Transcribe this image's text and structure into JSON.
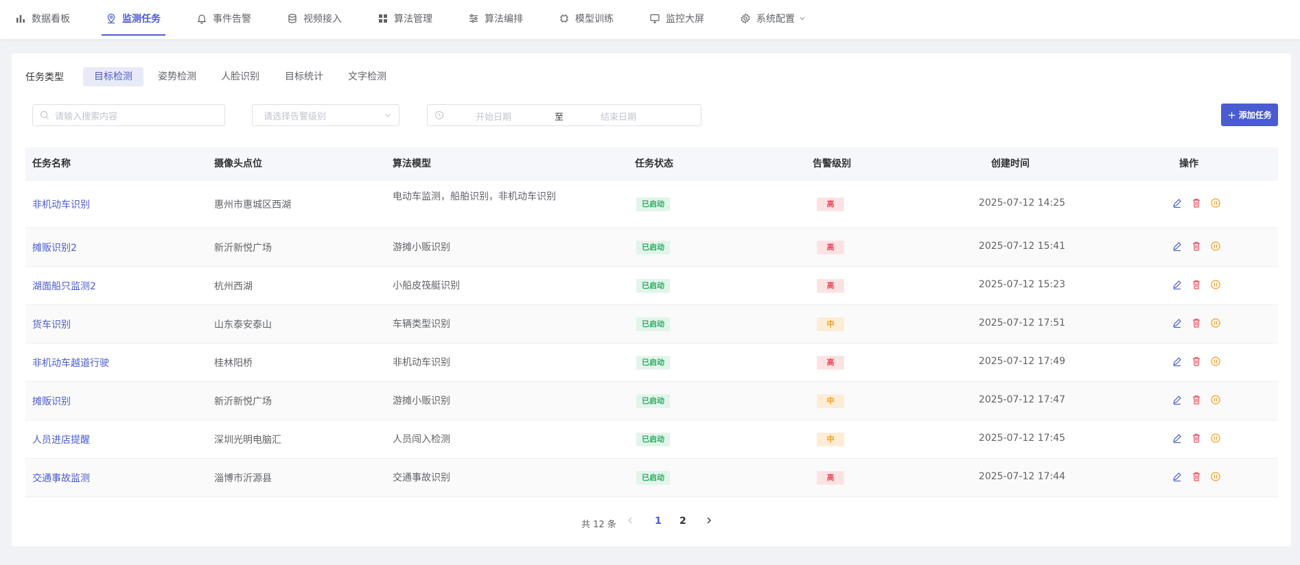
{
  "nav": {
    "items": [
      {
        "label": "数据看板",
        "icon": "bar-chart-icon"
      },
      {
        "label": "监测任务",
        "icon": "location-pin-icon"
      },
      {
        "label": "事件告警",
        "icon": "bell-icon"
      },
      {
        "label": "视频接入",
        "icon": "database-icon"
      },
      {
        "label": "算法管理",
        "icon": "grid-icon"
      },
      {
        "label": "算法编排",
        "icon": "sliders-icon"
      },
      {
        "label": "模型训练",
        "icon": "chip-icon"
      },
      {
        "label": "监控大屏",
        "icon": "monitor-icon"
      },
      {
        "label": "系统配置",
        "icon": "gear-icon"
      }
    ],
    "active_index": 1
  },
  "filters": {
    "task_type_label": "任务类型",
    "tabs": [
      "目标检测",
      "姿势检测",
      "人脸识别",
      "目标统计",
      "文字检测"
    ],
    "active_tab": 0,
    "search_placeholder": "请输入搜索内容",
    "alert_level_placeholder": "请选择告警级别",
    "date_start_placeholder": "开始日期",
    "date_separator": "至",
    "date_end_placeholder": "结束日期",
    "add_button_label": "添加任务"
  },
  "table": {
    "columns": [
      "任务名称",
      "摄像头点位",
      "算法模型",
      "任务状态",
      "告警级别",
      "创建时间",
      "操作"
    ],
    "rows": [
      {
        "name": "非机动车识别",
        "camera": "惠州市惠城区西湖",
        "algo": "电动车监测，船舶识别，非机动车识别",
        "status": "已启动",
        "level": "高",
        "level_type": "high",
        "time": "2025-07-12 14:25"
      },
      {
        "name": "摊贩识别2",
        "camera": "新沂新悦广场",
        "algo": "游摊小贩识别",
        "status": "已启动",
        "level": "高",
        "level_type": "high",
        "time": "2025-07-12 15:41"
      },
      {
        "name": "湖面船只监测2",
        "camera": "杭州西湖",
        "algo": "小船皮筏艇识别",
        "status": "已启动",
        "level": "高",
        "level_type": "high",
        "time": "2025-07-12 15:23"
      },
      {
        "name": "货车识别",
        "camera": "山东泰安泰山",
        "algo": "车辆类型识别",
        "status": "已启动",
        "level": "中",
        "level_type": "mid",
        "time": "2025-07-12 17:51"
      },
      {
        "name": "非机动车越道行驶",
        "camera": "桂林阳桥",
        "algo": "非机动车识别",
        "status": "已启动",
        "level": "高",
        "level_type": "high",
        "time": "2025-07-12 17:49"
      },
      {
        "name": "摊贩识别",
        "camera": "新沂新悦广场",
        "algo": "游摊小贩识别",
        "status": "已启动",
        "level": "中",
        "level_type": "mid",
        "time": "2025-07-12 17:47"
      },
      {
        "name": "人员进店提醒",
        "camera": "深圳光明电脑汇",
        "algo": "人员闯入检测",
        "status": "已启动",
        "level": "中",
        "level_type": "mid",
        "time": "2025-07-12 17:45"
      },
      {
        "name": "交通事故监测",
        "camera": "淄博市沂源县",
        "algo": "交通事故识别",
        "status": "已启动",
        "level": "高",
        "level_type": "high",
        "time": "2025-07-12 17:44"
      }
    ]
  },
  "pagination": {
    "total_label": "共 12 条",
    "pages": [
      "1",
      "2"
    ],
    "current_page": "1"
  },
  "colors": {
    "accent": "#4a5cd0",
    "status_green": "#2fa963",
    "level_high": "#f04b5a",
    "level_mid": "#f39a16"
  }
}
